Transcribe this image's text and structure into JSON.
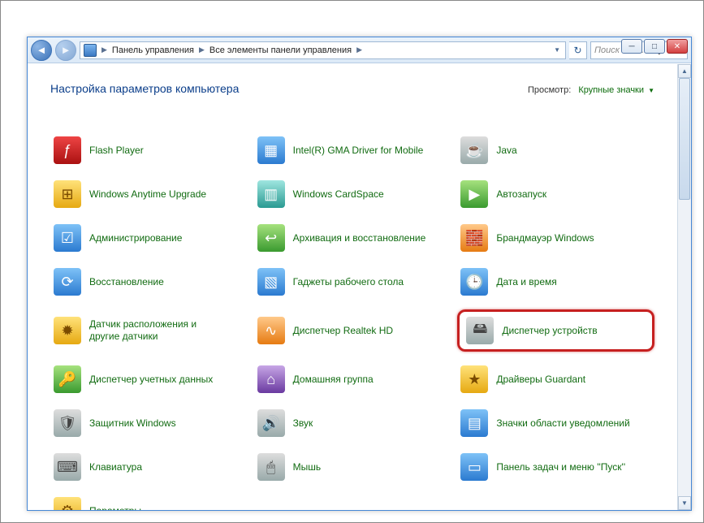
{
  "window": {
    "min_tooltip": "Minimize",
    "max_tooltip": "Maximize",
    "close_tooltip": "Close"
  },
  "breadcrumb": {
    "root": "Панель управления",
    "sub": "Все элементы панели управления"
  },
  "search": {
    "placeholder": "Поиск в па..."
  },
  "header": {
    "title": "Настройка параметров компьютера",
    "view_label": "Просмотр:",
    "view_value": "Крупные значки"
  },
  "items": [
    {
      "label": "Flash Player",
      "icon": "flash",
      "cls": "ic-red",
      "hl": false
    },
    {
      "label": "Intel(R) GMA Driver for Mobile",
      "icon": "intel",
      "cls": "ic-blue",
      "hl": false
    },
    {
      "label": "Java",
      "icon": "java",
      "cls": "ic-gray",
      "hl": false
    },
    {
      "label": "Windows Anytime Upgrade",
      "icon": "upgrade",
      "cls": "ic-yellow",
      "hl": false
    },
    {
      "label": "Windows CardSpace",
      "icon": "cardspace",
      "cls": "ic-teal",
      "hl": false
    },
    {
      "label": "Автозапуск",
      "icon": "autoplay",
      "cls": "ic-green",
      "hl": false
    },
    {
      "label": "Администрирование",
      "icon": "admin",
      "cls": "ic-blue",
      "hl": false
    },
    {
      "label": "Архивация и восстановление",
      "icon": "backup",
      "cls": "ic-green",
      "hl": false
    },
    {
      "label": "Брандмауэр Windows",
      "icon": "firewall",
      "cls": "ic-orange",
      "hl": false
    },
    {
      "label": "Восстановление",
      "icon": "recovery",
      "cls": "ic-blue",
      "hl": false
    },
    {
      "label": "Гаджеты рабочего стола",
      "icon": "gadgets",
      "cls": "ic-blue",
      "hl": false
    },
    {
      "label": "Дата и время",
      "icon": "datetime",
      "cls": "ic-blue",
      "hl": false
    },
    {
      "label": "Датчик расположения и другие датчики",
      "icon": "sensor",
      "cls": "ic-yellow",
      "hl": false
    },
    {
      "label": "Диспетчер Realtek HD",
      "icon": "realtek",
      "cls": "ic-orange",
      "hl": false
    },
    {
      "label": "Диспетчер устройств",
      "icon": "devmgr",
      "cls": "ic-gray",
      "hl": true
    },
    {
      "label": "Диспетчер учетных данных",
      "icon": "cred",
      "cls": "ic-green",
      "hl": false
    },
    {
      "label": "Домашняя группа",
      "icon": "homegroup",
      "cls": "ic-purple",
      "hl": false
    },
    {
      "label": "Драйверы Guardant",
      "icon": "guardant",
      "cls": "ic-yellow",
      "hl": false
    },
    {
      "label": "Защитник Windows",
      "icon": "defender",
      "cls": "ic-gray",
      "hl": false
    },
    {
      "label": "Звук",
      "icon": "sound",
      "cls": "ic-gray",
      "hl": false
    },
    {
      "label": "Значки области уведомлений",
      "icon": "tray",
      "cls": "ic-blue",
      "hl": false
    },
    {
      "label": "Клавиатура",
      "icon": "keyboard",
      "cls": "ic-gray",
      "hl": false
    },
    {
      "label": "Мышь",
      "icon": "mouse",
      "cls": "ic-gray",
      "hl": false
    },
    {
      "label": "Панель задач и меню ''Пуск''",
      "icon": "taskbar",
      "cls": "ic-blue",
      "hl": false
    },
    {
      "label": "Параметры",
      "icon": "params",
      "cls": "ic-yellow",
      "hl": false
    }
  ]
}
